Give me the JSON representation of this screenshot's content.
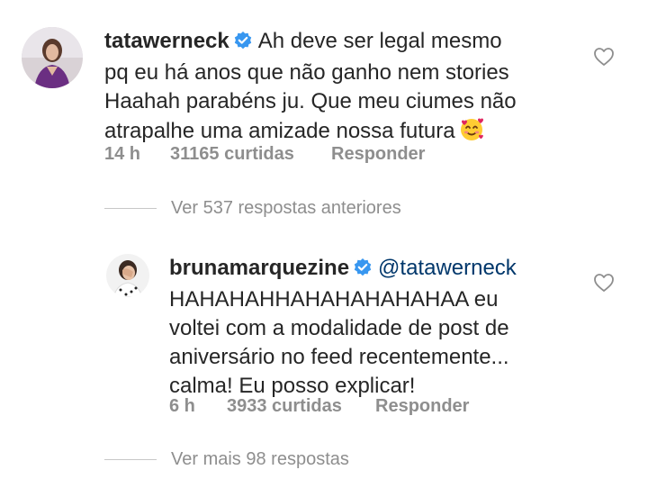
{
  "comments": [
    {
      "username": "tatawerneck",
      "verified": true,
      "text_lines": [
        "Ah deve ser legal mesmo",
        "pq eu há anos que não ganho nem stories",
        "Haahah parabéns ju. Que meu ciumes não",
        "atrapalhe uma amizade nossa futura"
      ],
      "emoji": "smiling-face-with-hearts",
      "time": "14 h",
      "likes": "31165 curtidas",
      "reply_label": "Responder",
      "like_icon": "heart-outline-icon"
    },
    {
      "username": "brunamarquezine",
      "verified": true,
      "mention": "@tatawerneck",
      "text_lines": [
        "HAHAHAHHAHAHAHAHAHAA eu",
        "voltei com a modalidade de post de",
        "aniversário no feed recentemente...",
        "calma! Eu posso explicar!"
      ],
      "time": "6 h",
      "likes": "3933 curtidas",
      "reply_label": "Responder",
      "like_icon": "heart-outline-icon"
    }
  ],
  "view_previous_replies": "Ver 537 respostas anteriores",
  "view_more_replies": "Ver mais 98 respostas",
  "colors": {
    "text": "#262626",
    "meta": "#8e8e8e",
    "verified": "#3897f0",
    "mention": "#00376b"
  }
}
